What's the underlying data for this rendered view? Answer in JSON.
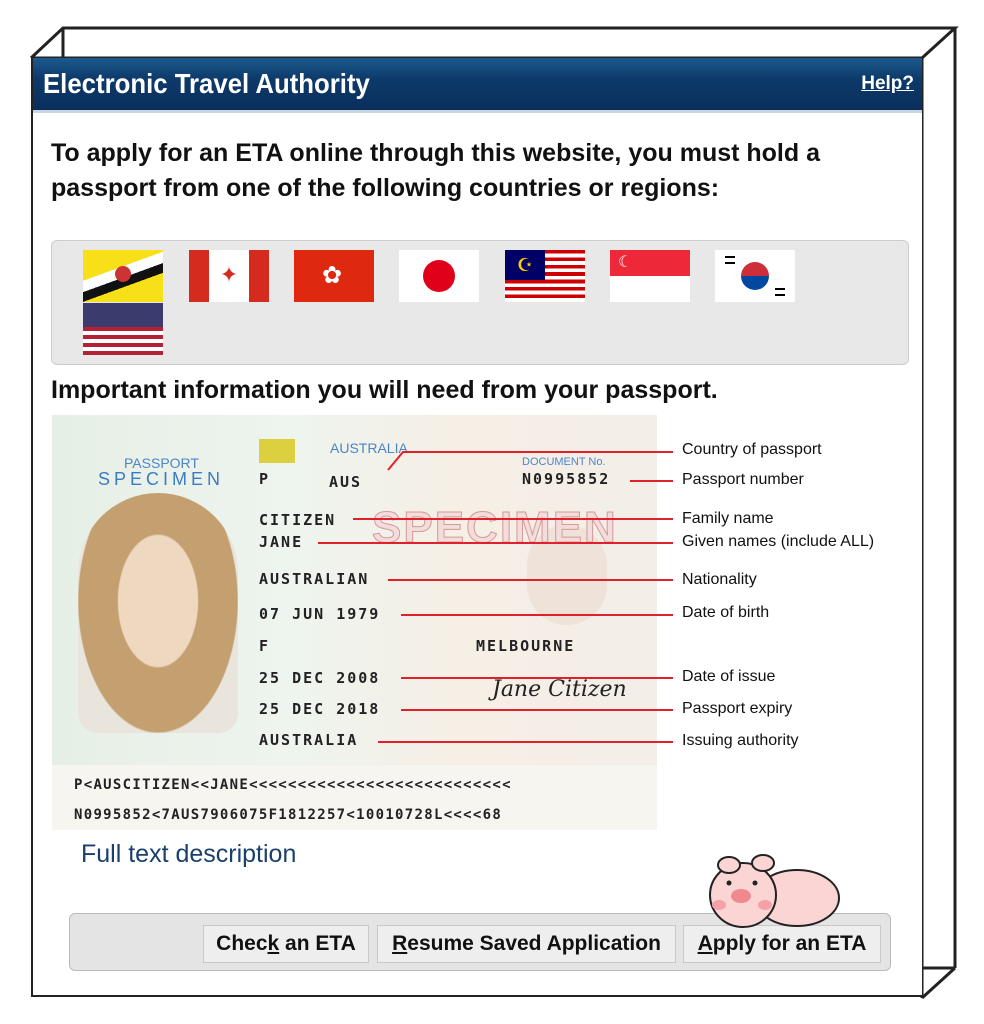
{
  "header": {
    "title": "Electronic Travel Authority",
    "help_link": "Help?"
  },
  "intro": "To apply for an ETA online through this website, you must hold a passport from one of the following countries or regions:",
  "flags": [
    "brunei-flag",
    "canada-flag",
    "hong-kong-flag",
    "japan-flag",
    "malaysia-flag",
    "singapore-flag",
    "south-korea-flag",
    "united-states-flag"
  ],
  "passport_heading": "Important information you will need from your passport.",
  "passport": {
    "passport_word": "PASSPORT",
    "specimen": "SPECIMEN",
    "country_header": "AUSTRALIA",
    "type": "P",
    "code": "AUS",
    "doc_label": "DOCUMENT No.",
    "doc_no": "N0995852",
    "surname": "CITIZEN",
    "given": "JANE",
    "nationality": "AUSTRALIAN",
    "dob": "07 JUN 1979",
    "sex": "F",
    "pob": "MELBOURNE",
    "issue": "25 DEC 2008",
    "expiry": "25 DEC 2018",
    "authority": "AUSTRALIA",
    "signature": "Jane Citizen",
    "watermark": "SPECIMEN",
    "mrz1": "P<AUSCITIZEN<<JANE<<<<<<<<<<<<<<<<<<<<<<<<<<<",
    "mrz2": "N0995852<7AUS7906075F1812257<10010728L<<<<68"
  },
  "labels": [
    "Country of passport",
    "Passport number",
    "Family name",
    "Given names (include ALL)",
    "Nationality",
    "Date of birth",
    "Date of issue",
    "Passport expiry",
    "Issuing authority"
  ],
  "full_text_link": "Full text description",
  "buttons": {
    "check_pre": "Chec",
    "check_u": "k",
    "check_post": " an ETA",
    "resume_u": "R",
    "resume_post": "esume Saved Application",
    "apply_u": "A",
    "apply_post": "pply for an ETA"
  }
}
